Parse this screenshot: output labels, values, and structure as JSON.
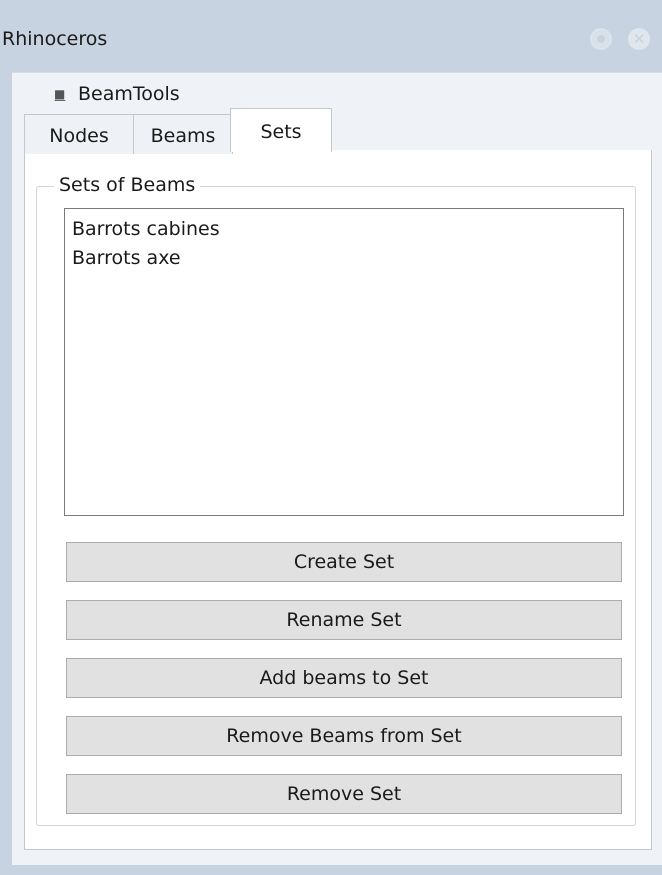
{
  "window": {
    "title": "Rhinoceros",
    "settings_icon": "gear-icon",
    "close_icon": "close-icon"
  },
  "panel": {
    "tab_label": "BeamTools",
    "tab_icon": "grip-icon"
  },
  "tabs": [
    {
      "label": "Nodes"
    },
    {
      "label": "Beams"
    },
    {
      "label": "Sets",
      "selected": true
    }
  ],
  "group": {
    "legend": "Sets of Beams",
    "items": [
      {
        "label": "Barrots cabines"
      },
      {
        "label": "Barrots axe"
      }
    ]
  },
  "buttons": {
    "create": "Create Set",
    "rename": "Rename Set",
    "add": "Add beams to Set",
    "remove_beams": "Remove Beams from Set",
    "remove_set": "Remove Set"
  },
  "colors": {
    "titlebar": "#c7d3e0",
    "panel": "#eff3f8",
    "button": "#e1e1e1"
  }
}
